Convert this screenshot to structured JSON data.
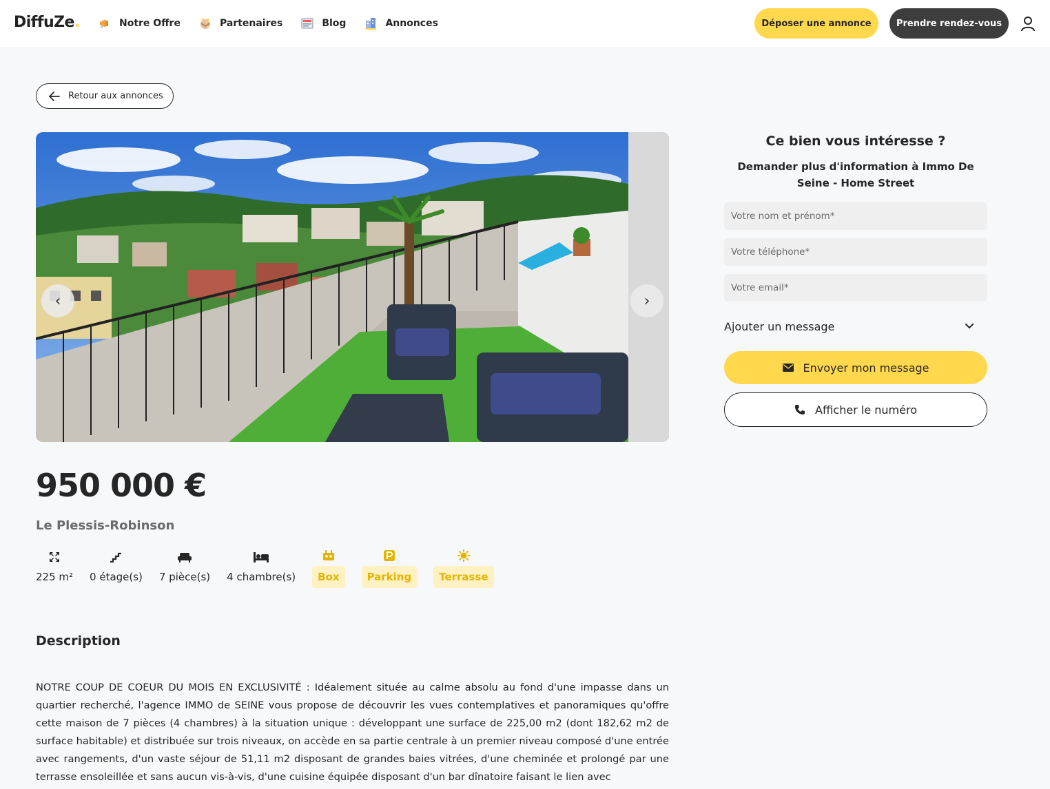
{
  "header": {
    "logo": "DiffuZe",
    "logo_dot": ".",
    "nav": [
      {
        "label": "Notre Offre",
        "icon": "megaphone-icon"
      },
      {
        "label": "Partenaires",
        "icon": "handshake-icon"
      },
      {
        "label": "Blog",
        "icon": "newspaper-icon"
      },
      {
        "label": "Annonces",
        "icon": "building-icon"
      }
    ],
    "deposer_label": "Déposer une annonce",
    "rdv_label": "Prendre rendez-vous",
    "accent_color": "#ffd84d"
  },
  "back_label": "Retour aux annonces",
  "gallery": {
    "prev_label": "‹",
    "next_label": "›"
  },
  "listing": {
    "price": "950 000 €",
    "location": "Le Plessis-Robinson",
    "features": [
      {
        "label": "225 m²",
        "icon": "expand-icon"
      },
      {
        "label": "0 étage(s)",
        "icon": "stairs-icon"
      },
      {
        "label": "7 pièce(s)",
        "icon": "couch-icon"
      },
      {
        "label": "4 chambre(s)",
        "icon": "bed-icon"
      }
    ],
    "tags": [
      {
        "label": "Box",
        "icon": "robot-icon"
      },
      {
        "label": "Parking",
        "icon": "parking-icon"
      },
      {
        "label": "Terrasse",
        "icon": "sun-icon"
      }
    ]
  },
  "description": {
    "title": "Description",
    "text": "NOTRE COUP DE COEUR DU MOIS EN EXCLUSIVITÉ : Idéalement située au calme absolu au fond d'une impasse dans un quartier recherché, l'agence IMMO de SEINE vous propose de découvrir les vues contemplatives et panoramiques qu'offre cette maison de 7 pièces (4 chambres) à la situation unique : développant une surface de 225,00 m2 (dont 182,62 m2 de surface habitable) et distribuée sur trois niveaux, on accède en sa partie centrale à un premier niveau composé d'une entrée avec rangements, d'un vaste séjour de 51,11 m2 disposant de grandes baies vitrées, d'une cheminée et prolongé par une terrasse ensoleillée et sans aucun vis-à-vis, d'une cuisine équipée disposant d'un bar dînatoire faisant le lien avec"
  },
  "contact": {
    "title": "Ce bien vous intéresse ?",
    "subtitle": "Demander plus d'information à Immo De Seine - Home Street",
    "name_placeholder": "Votre nom et prénom*",
    "phone_placeholder": "Votre téléphone*",
    "email_placeholder": "Votre email*",
    "message_toggle": "Ajouter un message",
    "send_label": "Envoyer mon message",
    "call_label": "Afficher le numéro"
  }
}
